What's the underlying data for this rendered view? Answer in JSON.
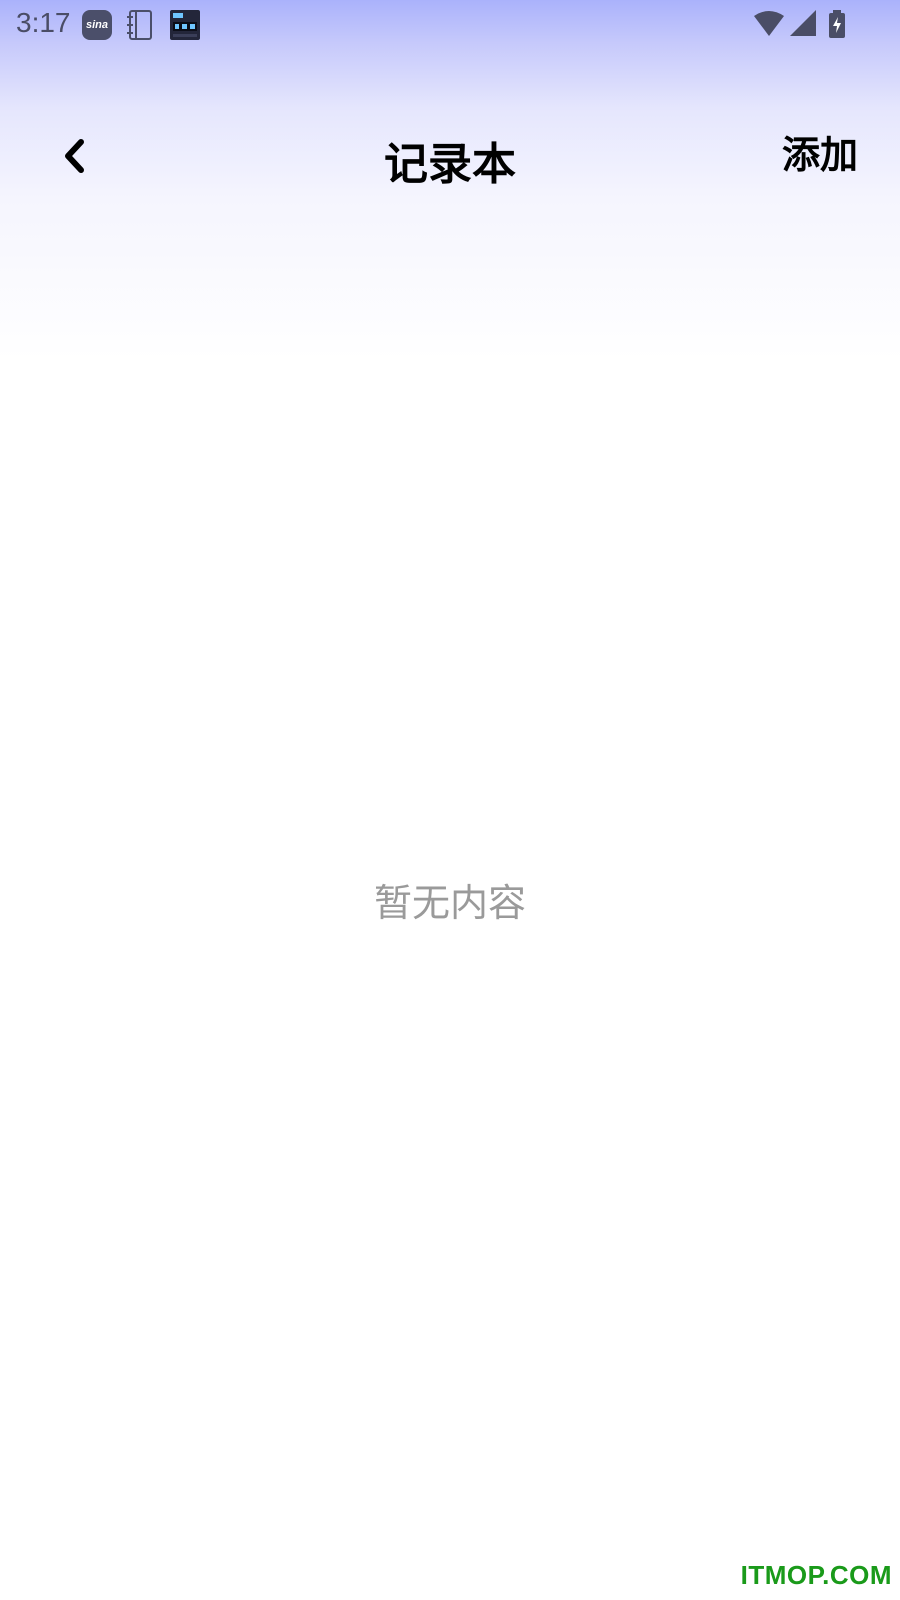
{
  "status_bar": {
    "time": "3:17",
    "notifications": [
      {
        "icon": "sina-weibo-icon",
        "text": "sina"
      },
      {
        "icon": "notebook-icon"
      },
      {
        "icon": "digital-clock-icon"
      }
    ],
    "system_icons": [
      "wifi-icon",
      "signal-icon",
      "battery-charging-icon"
    ]
  },
  "top_bar": {
    "back_icon": "chevron-left-icon",
    "title": "记录本",
    "add_label": "添加"
  },
  "content": {
    "empty_message": "暂无内容"
  },
  "watermark": {
    "text": "ITMOP.COM"
  },
  "colors": {
    "gradient_top": "#aab2fb",
    "background": "#ffffff",
    "empty_text": "#9a9a9a",
    "watermark": "#1a9a1a"
  }
}
